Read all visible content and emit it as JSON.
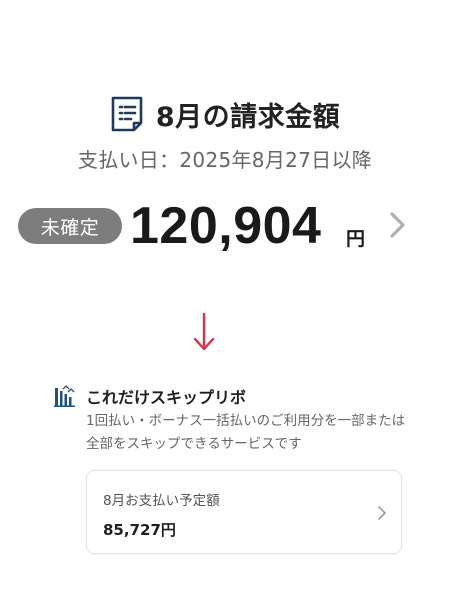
{
  "bill": {
    "title": "8月の請求金額",
    "due_date": "支払い日：2025年8月27日以降",
    "status_badge": "未確定",
    "amount": "120,904",
    "unit": "円"
  },
  "skip_service": {
    "title": "これだけスキップリボ",
    "description": "1回払い・ボーナス一括払いのご利用分を一部または全部をスキップできるサービスです",
    "card": {
      "label": "8月お支払い予定額",
      "value": "85,727円"
    }
  },
  "icons": {
    "title": "document-icon",
    "amount_nav": "chevron-right-icon",
    "flow": "arrow-down-icon",
    "skip": "bar-chart-icon",
    "card_nav": "chevron-right-icon"
  },
  "colors": {
    "title_icon": "#1f3a5c",
    "badge_bg": "#7d7d7d",
    "arrow": "#d6334a",
    "skip_icon": "#1f4f8f",
    "chevron": "#b0b0b0"
  }
}
